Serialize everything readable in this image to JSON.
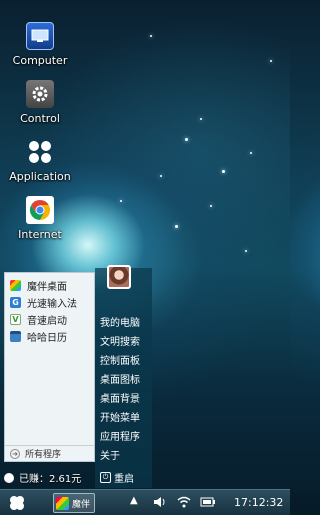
{
  "desktop": {
    "icons": [
      {
        "label": "Computer",
        "icon": "monitor-icon"
      },
      {
        "label": "Control",
        "icon": "gear-icon"
      },
      {
        "label": "Application",
        "icon": "apps-grid-icon"
      },
      {
        "label": "Internet",
        "icon": "chrome-icon"
      }
    ]
  },
  "start_menu": {
    "left_items": [
      {
        "label": "魔伴桌面",
        "icon": "pinwheel-icon"
      },
      {
        "label": "光速输入法",
        "icon": "input-method-icon"
      },
      {
        "label": "音速启动",
        "icon": "v-launcher-icon"
      },
      {
        "label": "哈哈日历",
        "icon": "calendar-icon"
      }
    ],
    "all_programs": "所有程序",
    "right_items": [
      "我的电脑",
      "文明搜索",
      "控制面板",
      "桌面图标",
      "桌面背景",
      "开始菜单",
      "应用程序",
      "关于"
    ],
    "earned": "已赚：2.61元",
    "restart": "重启"
  },
  "taskbar": {
    "app_label": "魔伴",
    "clock": "17:12:32",
    "colors": {
      "accent": "#2c4f60"
    }
  }
}
